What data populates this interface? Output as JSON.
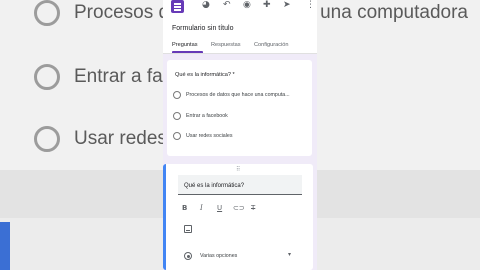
{
  "background": {
    "options": [
      "Procesos de datos que hace una computadora",
      "Entrar a facebook",
      "Usar redes sociales"
    ]
  },
  "toolbar": {
    "icons": [
      "forms-logo",
      "palette-icon",
      "undo-icon",
      "preview-icon",
      "add-collaborator-icon",
      "send-icon",
      "more-vert-icon"
    ]
  },
  "form": {
    "title": "Formulario sin título",
    "tabs": [
      "Preguntas",
      "Respuestas",
      "Configuración"
    ],
    "active_tab": "Preguntas"
  },
  "question_preview": {
    "title": "Qué es la informática? *",
    "options": [
      "Procesos de datos que hace una computa...",
      "Entrar a facebook",
      "Usar redes sociales"
    ]
  },
  "question_editor": {
    "question_text": "Qué es la informática?",
    "format_tools": [
      "B",
      "I",
      "U",
      "link",
      "clear-format"
    ],
    "type_label": "Varias opciones"
  },
  "colors": {
    "accent": "#673ab7",
    "focus": "#4285f4",
    "form_background": "#f0ebf8"
  }
}
